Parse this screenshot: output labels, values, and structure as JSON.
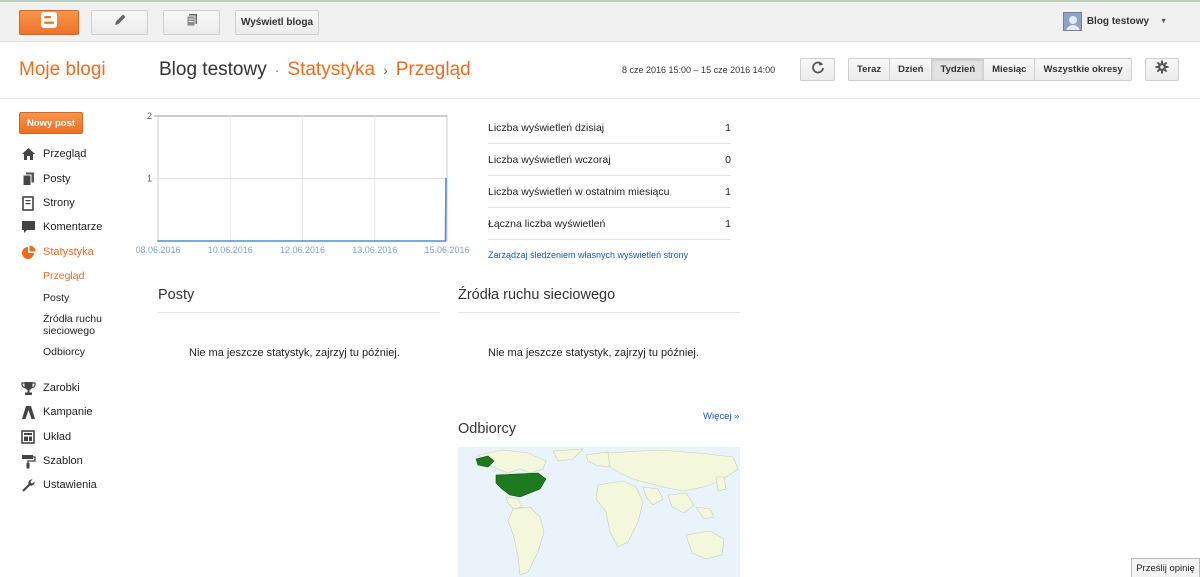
{
  "toolbar": {
    "view_blog_label": "Wyświetl bloga",
    "user_name": "Blog testowy",
    "icons": [
      "blogger-logo-icon",
      "pencil-icon",
      "posts-list-icon",
      "avatar",
      "chevron-down-icon"
    ]
  },
  "header": {
    "my_blogs": "Moje blogi",
    "blog_name": "Blog testowy",
    "separator": "·",
    "section": "Statystyka",
    "arrow": "›",
    "page": "Przegląd",
    "date_range": "8 cze 2016 15:00 – 15 cze 2016 14:00",
    "ranges": [
      "Teraz",
      "Dzień",
      "Tydzień",
      "Miesiąc",
      "Wszystkie okresy"
    ],
    "active_range": "Tydzień"
  },
  "sidebar": {
    "new_post": "Nowy post",
    "items": [
      {
        "label": "Przegląd",
        "icon": "home-icon"
      },
      {
        "label": "Posty",
        "icon": "posts-icon"
      },
      {
        "label": "Strony",
        "icon": "pages-icon"
      },
      {
        "label": "Komentarze",
        "icon": "comment-icon"
      },
      {
        "label": "Statystyka",
        "icon": "pie-chart-icon",
        "active": true
      },
      {
        "label": "Zarobki",
        "icon": "trophy-icon"
      },
      {
        "label": "Kampanie",
        "icon": "campaign-icon"
      },
      {
        "label": "Układ",
        "icon": "layout-icon"
      },
      {
        "label": "Szablon",
        "icon": "paint-roller-icon"
      },
      {
        "label": "Ustawienia",
        "icon": "wrench-icon"
      }
    ],
    "sub_items": [
      {
        "label": "Przegląd",
        "active": true
      },
      {
        "label": "Posty"
      },
      {
        "label": "Źródła ruchu sieciowego"
      },
      {
        "label": "Odbiorcy"
      }
    ],
    "accent": "#f26b1d"
  },
  "chart_data": {
    "type": "line",
    "x": [
      "08.06.2016",
      "10.06.2016",
      "12.06.2016",
      "13.06.2016",
      "15.06.2016"
    ],
    "series": [
      {
        "values": [
          0,
          0,
          0,
          0,
          1
        ]
      }
    ],
    "ylim": [
      0,
      2
    ],
    "yticks": [
      "1",
      "2"
    ],
    "grid": true,
    "line_color": "#4a90d9"
  },
  "stats": {
    "rows": [
      {
        "label": "Liczba wyświetleń dzisiaj",
        "value": "1"
      },
      {
        "label": "Liczba wyświetleń wczoraj",
        "value": "0"
      },
      {
        "label": "Liczba wyświetleń w ostatnim miesiącu",
        "value": "1"
      },
      {
        "label": "Łączna liczba wyświetleń",
        "value": "1"
      }
    ],
    "manage_link": "Zarządzaj śledzeniem własnych wyświetleń strony"
  },
  "sections": {
    "posts_title": "Posty",
    "posts_empty": "Nie ma jeszcze statystyk, zajrzyj tu później.",
    "traffic_title": "Źródła ruchu sieciowego",
    "traffic_empty": "Nie ma jeszcze statystyk, zajrzyj tu później.",
    "audience_title": "Odbiorcy",
    "more_link": "Więcej »"
  },
  "feedback": "Prześlij opinię"
}
